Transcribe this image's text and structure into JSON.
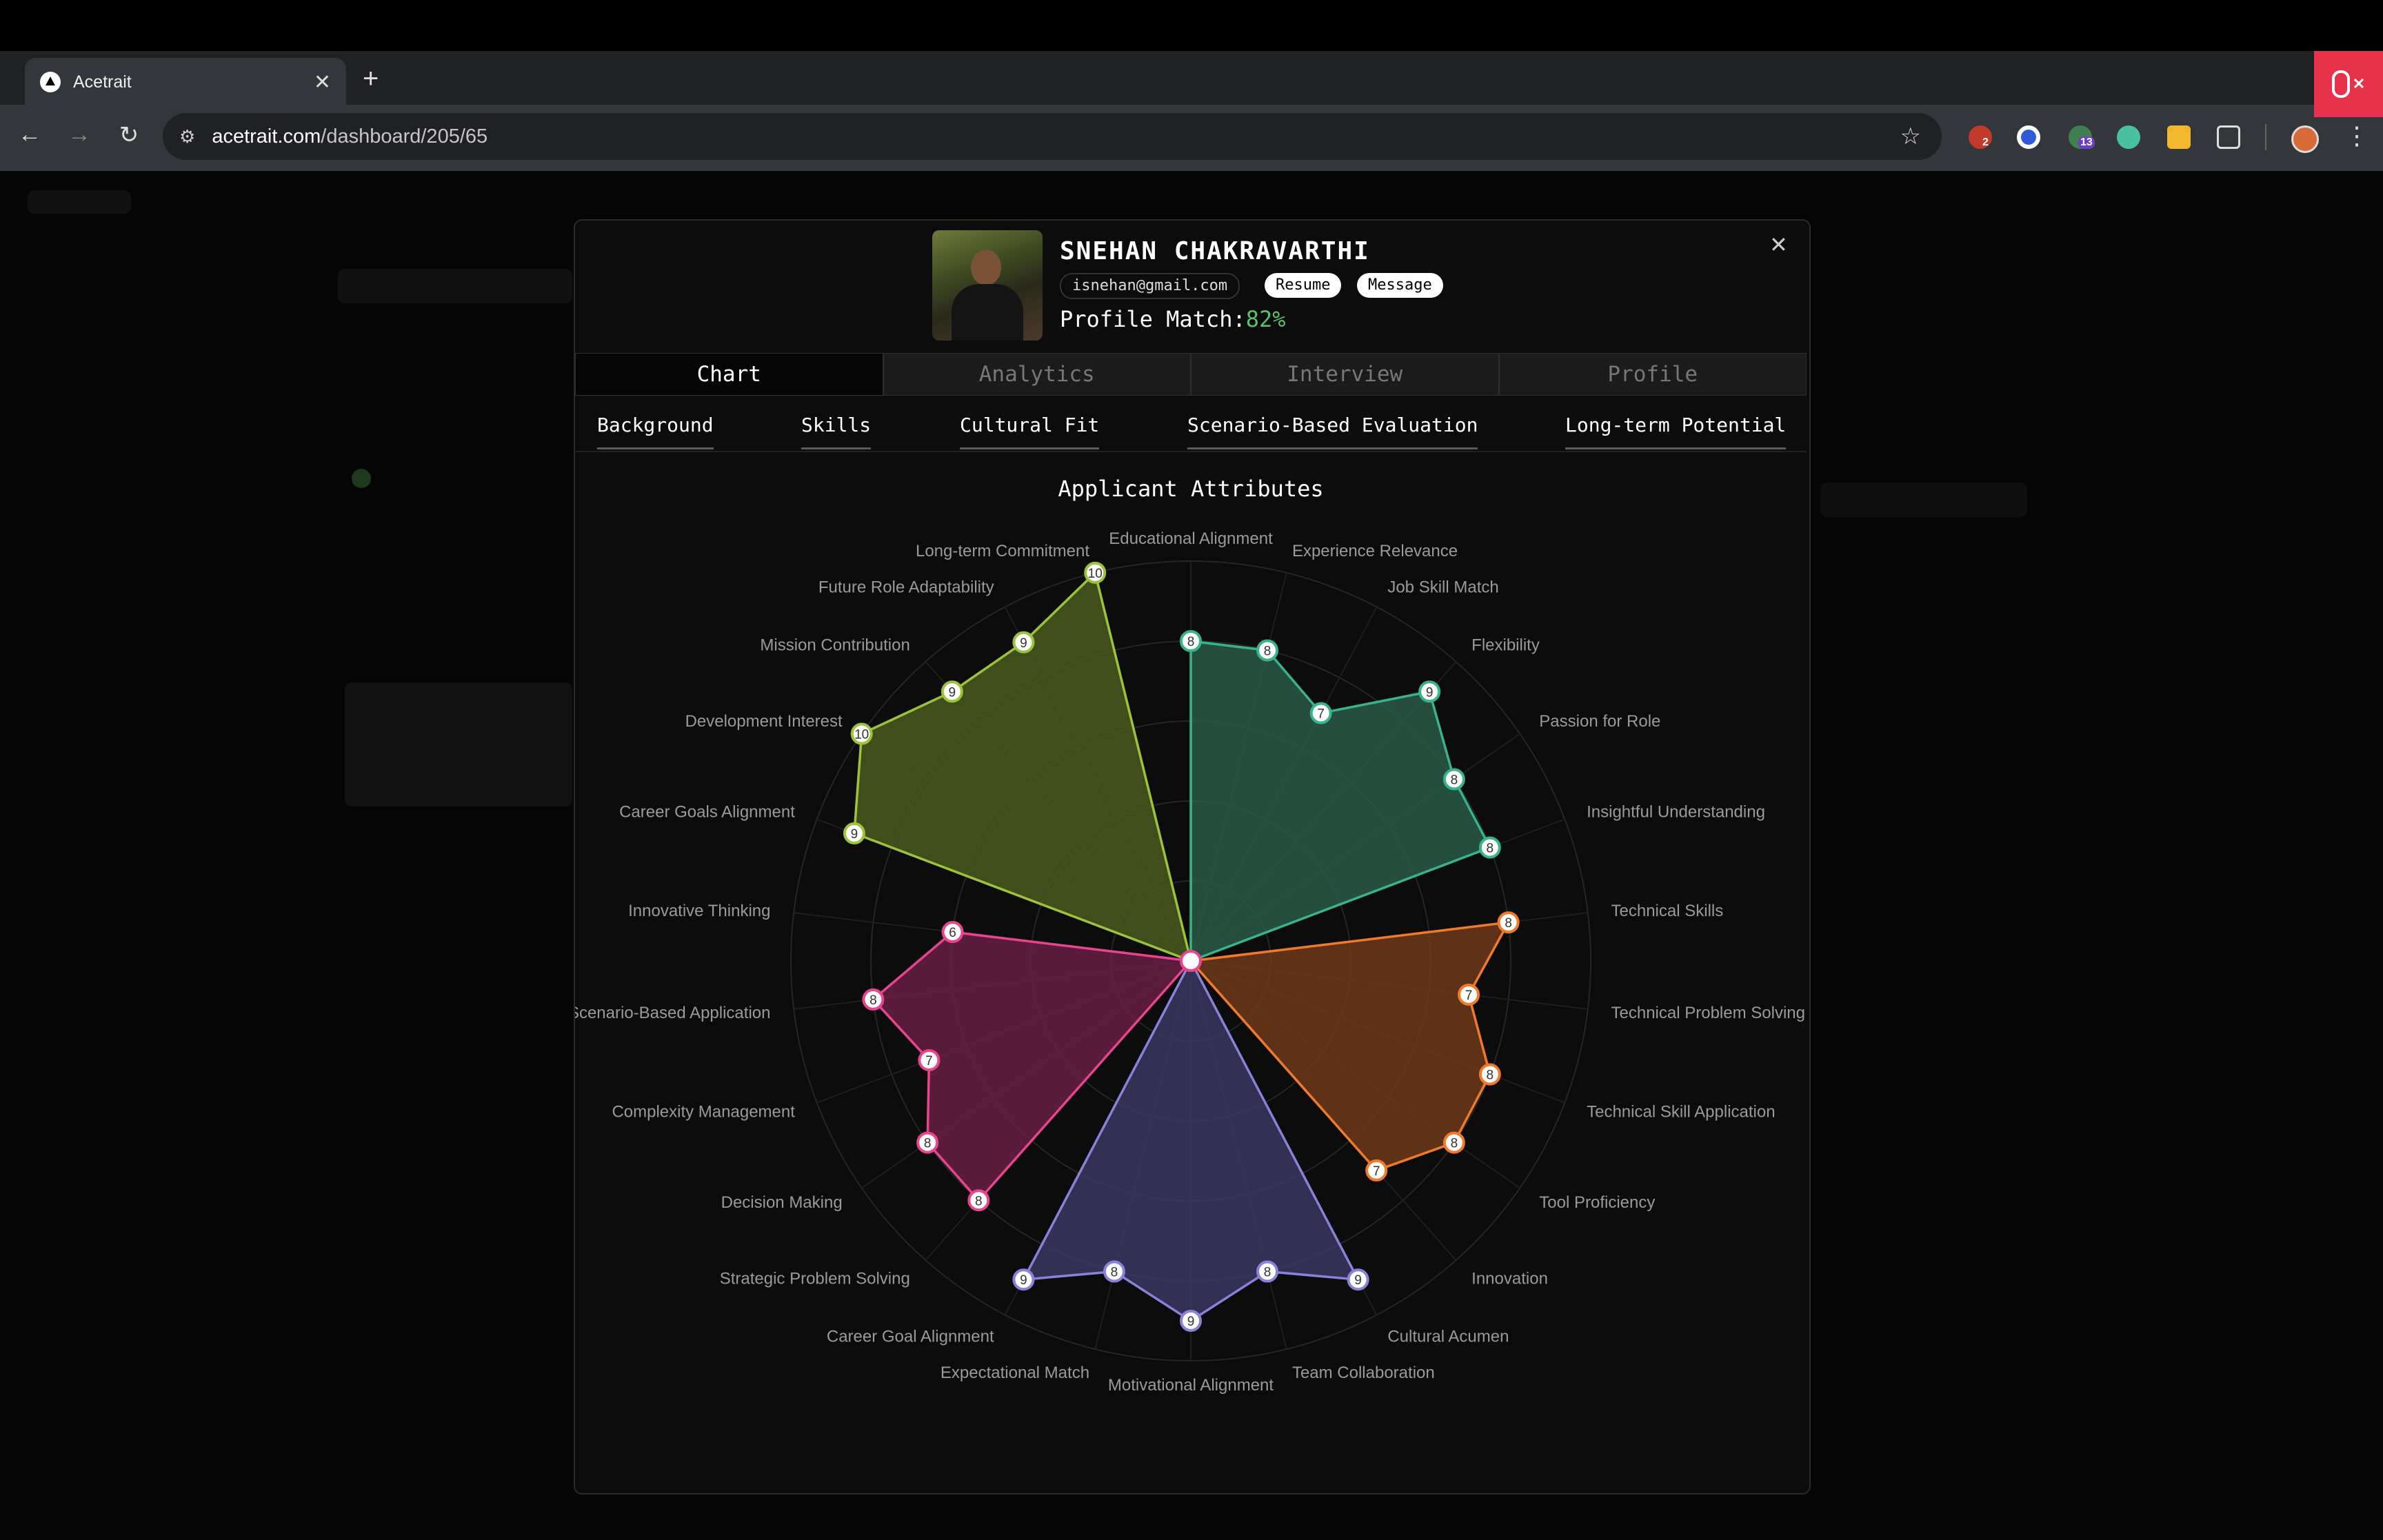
{
  "browser": {
    "tab_title": "Acetrait",
    "url_domain": "acetrait.com",
    "url_path": "/dashboard/205/65",
    "extension_badges": [
      "2",
      "13"
    ]
  },
  "candidate": {
    "name": "SNEHAN CHAKRAVARTHI",
    "email": "isnehan@gmail.com",
    "resume_label": "Resume",
    "message_label": "Message",
    "match_label": "Profile Match:",
    "match_value": "82%"
  },
  "main_tabs": [
    "Chart",
    "Analytics",
    "Interview",
    "Profile"
  ],
  "sub_tabs": [
    "Background",
    "Skills",
    "Cultural Fit",
    "Scenario-Based Evaluation",
    "Long-term Potential"
  ],
  "colors": {
    "background": "#38b48a",
    "skills": "#f07a2a",
    "cultural": "#8a82d8",
    "scenario": "#e8448f",
    "longterm": "#9cc43a",
    "match_green": "#59c26b"
  },
  "chart_data": {
    "type": "radar",
    "title": "Applicant Attributes",
    "rmax": 10,
    "groups": [
      {
        "name": "Background",
        "color": "#38b48a",
        "fill": "#2a5a48",
        "labels": [
          "Educational Alignment",
          "Experience Relevance",
          "Job Skill Match",
          "Flexibility",
          "Passion for Role",
          "Insightful Understanding"
        ],
        "values": [
          8,
          8,
          7,
          9,
          8,
          8
        ]
      },
      {
        "name": "Skills",
        "color": "#f07a2a",
        "fill": "#6e3a1a",
        "labels": [
          "Technical Skills",
          "Technical Problem Solving",
          "Technical Skill Application",
          "Tool Proficiency",
          "Innovation"
        ],
        "values": [
          8,
          7,
          8,
          8,
          7
        ]
      },
      {
        "name": "Cultural Fit",
        "color": "#8a82d8",
        "fill": "#3a3760",
        "labels": [
          "Cultural Acumen",
          "Team Collaboration",
          "Motivational Alignment",
          "Expectational Match",
          "Career Goal Alignment"
        ],
        "values": [
          9,
          8,
          9,
          8,
          9
        ]
      },
      {
        "name": "Scenario-Based Evaluation",
        "color": "#e8448f",
        "fill": "#6a1f44",
        "labels": [
          "Strategic Problem Solving",
          "Decision Making",
          "Complexity Management",
          "Scenario-Based Application",
          "Innovative Thinking"
        ],
        "values": [
          8,
          8,
          7,
          8,
          6
        ]
      },
      {
        "name": "Long-term Potential",
        "color": "#9cc43a",
        "fill": "#4a5a1e",
        "labels": [
          "Career Goals Alignment",
          "Development Interest",
          "Mission Contribution",
          "Future Role Adaptability",
          "Long-term Commitment"
        ],
        "values": [
          9,
          10,
          9,
          9,
          10
        ]
      }
    ]
  }
}
